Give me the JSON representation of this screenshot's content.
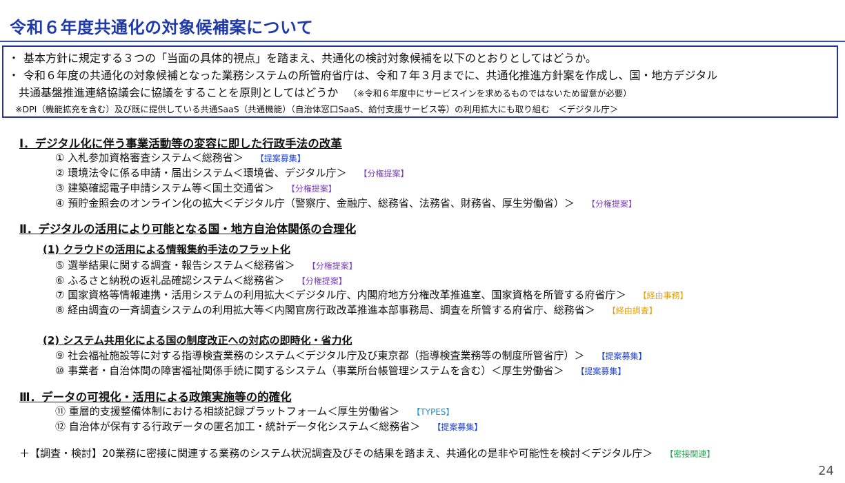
{
  "title": "令和６年度共通化の対象候補案について",
  "box": {
    "bullet": "・",
    "line1": "基本方針に規定する３つの「当面の具体的視点」を踏まえ、共通化の検討対象候補を以下のとおりとしてはどうか。",
    "line2": "令和６年度の共通化の対象候補となった業務システムの所管府省庁は、令和７年３月までに、共通化推進方針案を作成し、国・地方デジタル",
    "line3": "共通基盤推進連絡協議会に協議をすることを原則としてはどうか",
    "line3_note": "（※令和６年度中にサービスインを求めるものではないため留意が必要）",
    "line4": "※DPI（機能拡充を含む）及び既に提供している共通SaaS（共通機能）（自治体窓口SaaS、給付支援サービス等）の利用拡大にも取り組む　＜デジタル庁＞"
  },
  "sections": {
    "s1": "Ⅰ．デジタル化に伴う事業活動等の変容に即した行政手法の改革",
    "s2": "Ⅱ．デジタルの活用により可能となる国・地方自治体関係の合理化",
    "s2_sub1": "(1) クラウドの活用による情報集約手法のフラット化",
    "s2_sub2": "(2) システム共用化による国の制度改正への対応の即時化・省力化",
    "s3": "Ⅲ．データの可視化・活用による政策実施等の的確化"
  },
  "items": [
    {
      "text": "① 入札参加資格審査システム＜総務省＞",
      "tag": "【提案募集】"
    },
    {
      "text": "② 環境法令に係る申請・届出システム＜環境省、デジタル庁＞",
      "tag": "【分権提案】"
    },
    {
      "text": "③ 建築確認電子申請システム等＜国土交通省＞",
      "tag": "【分権提案】"
    },
    {
      "text": "④ 預貯金照会のオンライン化の拡大＜デジタル庁（警察庁、金融庁、総務省、法務省、財務省、厚生労働省）＞",
      "tag": "【分権提案】"
    },
    {
      "text": "⑤ 選挙結果に関する調査・報告システム＜総務省＞",
      "tag": "【分権提案】"
    },
    {
      "text": "⑥ ふるさと納税の返礼品確認システム＜総務省＞",
      "tag": "【分権提案】"
    },
    {
      "text": "⑦ 国家資格等情報連携・活用システムの利用拡大＜デジタル庁、内閣府地方分権改革推進室、国家資格を所管する府省庁＞",
      "tag": "【経由事務】"
    },
    {
      "text": "⑧ 経由調査の一斉調査システムの利用拡大等＜内閣官房行政改革推進本部事務局、調査を所管する府省庁、総務省＞",
      "tag": "【経由調査】"
    },
    {
      "text": "⑨ 社会福祉施設等に対する指導検査業務のシステム＜デジタル庁及び東京都（指導検査業務等の制度所管省庁）＞",
      "tag": "【提案募集】"
    },
    {
      "text": "⑩ 事業者・自治体間の障害福祉関係手続に関するシステム（事業所台帳管理システムを含む）＜厚生労働省＞",
      "tag": "【提案募集】"
    },
    {
      "text": "⑪ 重層的支援整備体制における相談記録プラットフォーム＜厚生労働省＞",
      "tag": "【TYPES】"
    },
    {
      "text": "⑫ 自治体が保有する行政データの匿名加工・統計データ化システム＜総務省＞",
      "tag": "【提案募集】"
    }
  ],
  "footer": {
    "text": "＋【調査・検討】20業務に密接に関連する業務のシステム状況調査及びその結果を踏まえ、共通化の是非や可能性を検討＜デジタル庁＞",
    "tag": "【密接関連】"
  },
  "page_number": "24"
}
